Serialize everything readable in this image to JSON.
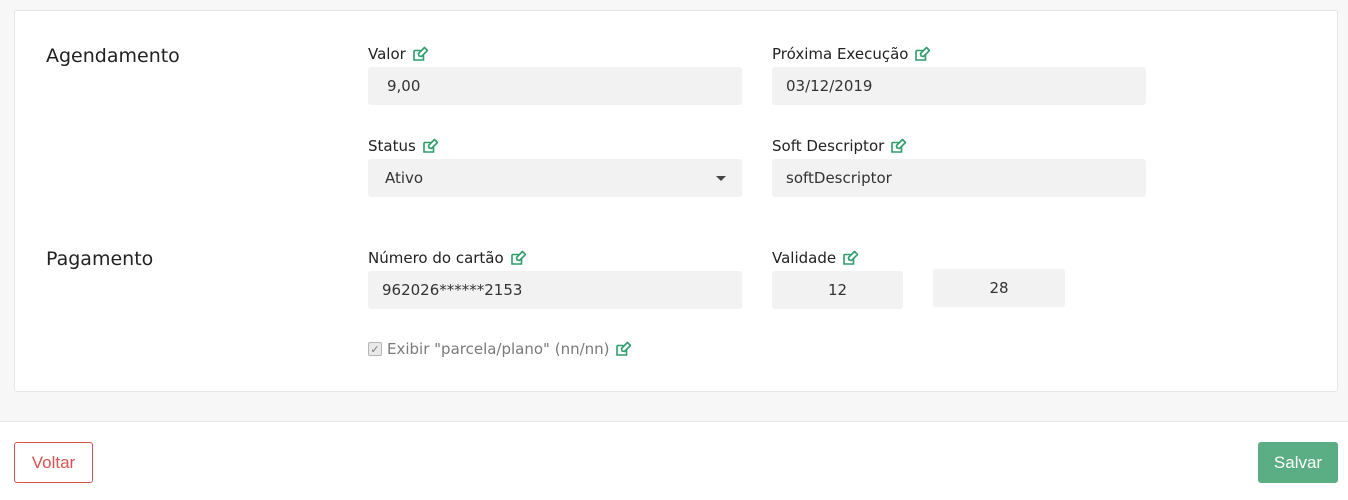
{
  "colors": {
    "accent": "#2e9e6a",
    "save_bg": "#5bad84",
    "back_border": "#d9534f"
  },
  "sections": {
    "agendamento": "Agendamento",
    "pagamento": "Pagamento"
  },
  "fields": {
    "valor": {
      "label": "Valor",
      "value": "9,00",
      "icon": "edit-icon"
    },
    "proxima_execucao": {
      "label": "Próxima Execução",
      "value": "03/12/2019",
      "icon": "edit-icon"
    },
    "status": {
      "label": "Status",
      "value": "Ativo",
      "icon": "edit-icon"
    },
    "soft_descriptor": {
      "label": "Soft Descriptor",
      "value": "softDescriptor",
      "icon": "edit-icon"
    },
    "numero_cartao": {
      "label": "Número do cartão",
      "value": "962026******2153",
      "icon": "edit-icon"
    },
    "validade": {
      "label": "Validade",
      "month": "12",
      "year": "28",
      "icon": "edit-icon"
    }
  },
  "checkbox": {
    "label": "Exibir \"parcela/plano\" (nn/nn)",
    "checked": true
  },
  "buttons": {
    "back": "Voltar",
    "save": "Salvar"
  }
}
